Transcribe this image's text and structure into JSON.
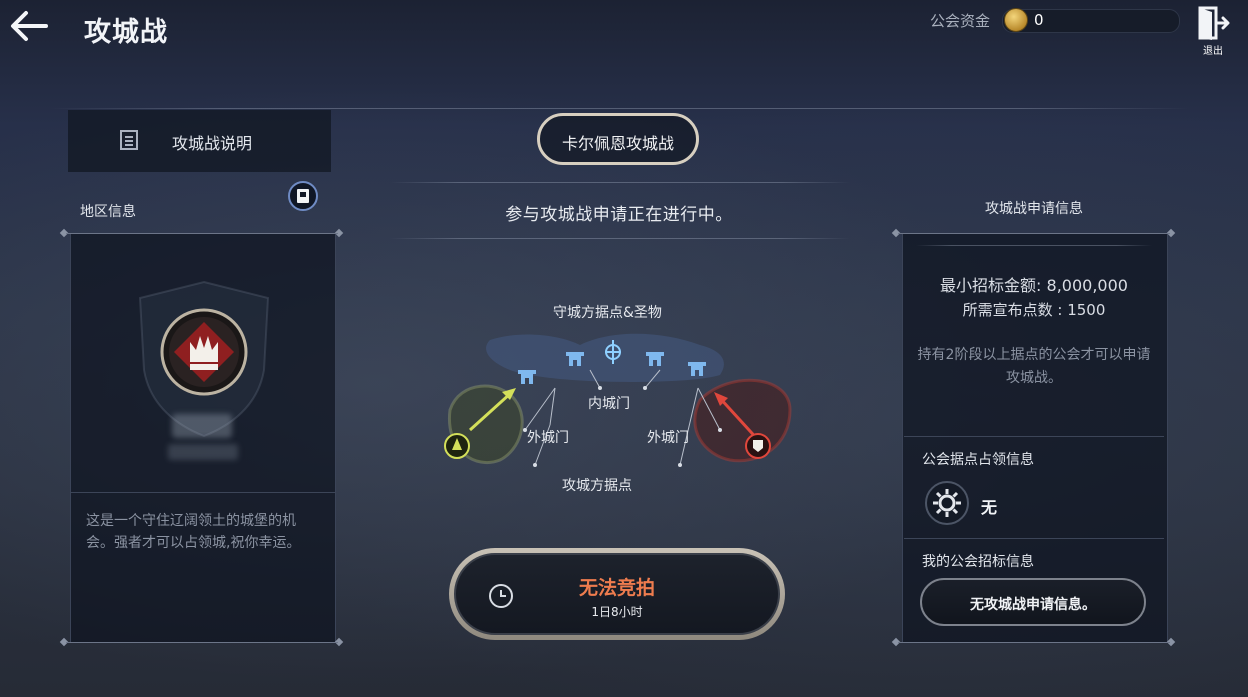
{
  "header": {
    "title": "攻城战",
    "funds_label": "公会资金",
    "funds_value": "0",
    "exit_label": "退出"
  },
  "tabs": {
    "explain_label": "攻城战说明",
    "castle_label": "卡尔佩恩攻城战"
  },
  "region": {
    "title": "地区信息",
    "description": "这是一个守住辽阔领土的城堡的机会。强者才可以占领城,祝你幸运。"
  },
  "center": {
    "status": "参与攻城战申请正在进行中。",
    "map_labels": {
      "defender": "守城方据点&圣物",
      "inner_gate": "内城门",
      "outer_gate_left": "外城门",
      "outer_gate_right": "外城门",
      "attacker": "攻城方据点"
    },
    "auction": {
      "label": "无法竞拍",
      "time": "1日8小时"
    }
  },
  "application": {
    "title": "攻城战申请信息",
    "min_bid": "最小招标金额: 8,000,000",
    "required_points": "所需宣布点数 : 1500",
    "requirement_note": "持有2阶段以上据点的公会才可以申请攻城战。",
    "occupy_title": "公会据点占领信息",
    "occupy_value": "无",
    "my_bid_title": "我的公会招标信息",
    "my_bid_button": "无攻城战申请信息。"
  },
  "colors": {
    "auction_text": "#ee7c4e",
    "attacker_arrow": "#e0473c",
    "defender_arrow": "#d4e05a",
    "gate_icon": "#7fb8ee"
  }
}
